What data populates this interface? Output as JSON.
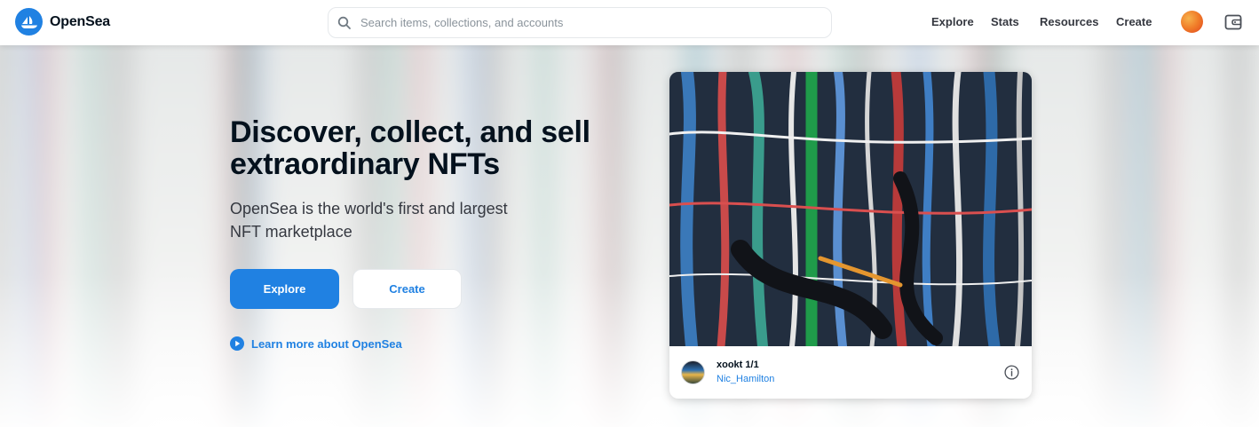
{
  "brand": {
    "name": "OpenSea"
  },
  "search": {
    "placeholder": "Search items, collections, and accounts",
    "value": ""
  },
  "nav": {
    "items": [
      "Explore",
      "Stats",
      "Resources",
      "Create"
    ]
  },
  "hero": {
    "title": "Discover, collect, and sell extraordinary NFTs",
    "subtitle": "OpenSea is the world's first and largest NFT marketplace",
    "primary_button": "Explore",
    "secondary_button": "Create",
    "learn_more": "Learn more about OpenSea"
  },
  "featured": {
    "nft_name": "xookt 1/1",
    "creator": "Nic_Hamilton"
  },
  "colors": {
    "accent": "#2081e2",
    "text_dark": "#04111d",
    "text_muted": "#353840",
    "border": "#e5e8eb"
  },
  "icons": {
    "brand": "opensea-boat-logo-icon",
    "search": "search-icon",
    "wallet": "wallet-icon",
    "play": "play-circle-icon",
    "info": "info-icon"
  }
}
